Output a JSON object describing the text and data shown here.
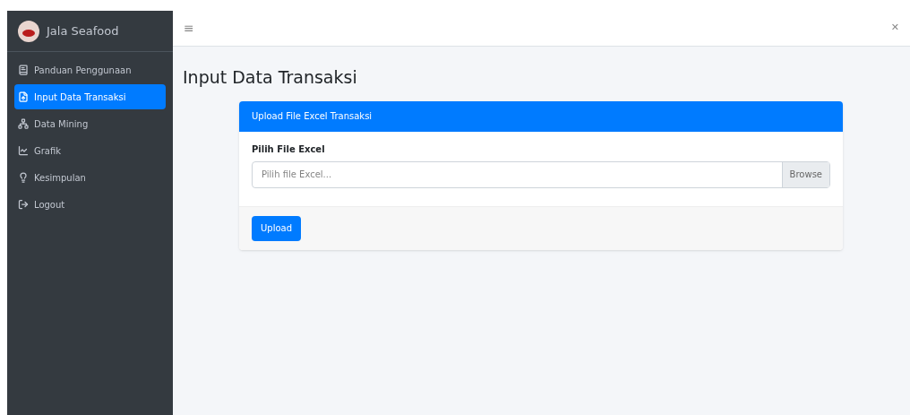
{
  "brand": {
    "name": "Jala Seafood"
  },
  "sidebar": {
    "items": [
      {
        "label": "Panduan Penggunaan",
        "kind": "guide",
        "selected": false
      },
      {
        "label": "Input Data Transaksi",
        "kind": "upload",
        "selected": true
      },
      {
        "label": "Data Mining",
        "kind": "mining",
        "selected": false
      },
      {
        "label": "Grafik",
        "kind": "chart",
        "selected": false
      },
      {
        "label": "Kesimpulan",
        "kind": "summary",
        "selected": false
      },
      {
        "label": "Logout",
        "kind": "logout",
        "selected": false
      }
    ]
  },
  "topbar": {
    "menu": "≡",
    "close": "✕"
  },
  "page_title": "Input Data Transaksi",
  "card": {
    "header": "Upload File Excel Transaksi",
    "field_label": "Pilih File Excel",
    "placeholder": "Pilih file Excel...",
    "browse": "Browse",
    "submit": "Upload"
  }
}
